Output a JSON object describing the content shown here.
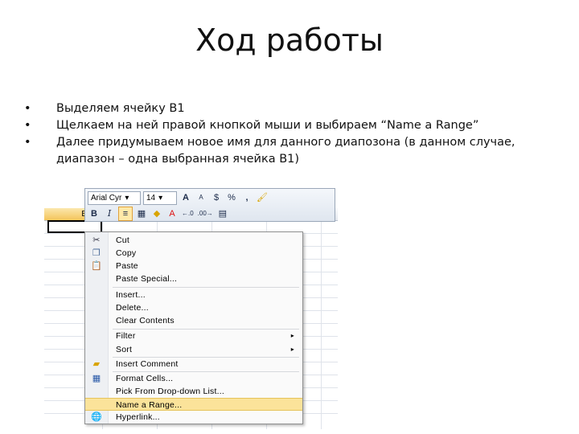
{
  "slide": {
    "title": "Ход работы",
    "bullets": [
      {
        "line1": "Выделяем ячейку B1",
        "line2": ""
      },
      {
        "line1": "Щелкаем на ней правой кнопкой мыши и выбираем “Name a Range”",
        "line2": ""
      },
      {
        "line1": "Далее придумываем новое имя для данного диапозона (в данном случае,",
        "line2": "диапазон – одна выбранная ячейка B1)"
      }
    ],
    "bullet_symbol": "•"
  },
  "screenshot": {
    "column_header": "B",
    "toolbar": {
      "font_name": "Arial Cyr",
      "font_size": "14",
      "dropdown_glyph": "▾",
      "grow_font": "A",
      "shrink_font": "A",
      "currency": "$",
      "percent": "%",
      "comma": ",",
      "format_painter": "🖌",
      "bold": "B",
      "italic": "I",
      "align_center": "≡",
      "borders": "▦",
      "fill_color": "◆",
      "font_color": "A",
      "inc_decimal": "←.0",
      "dec_decimal": ".00→",
      "merge": "▤"
    },
    "menu": {
      "items": [
        {
          "label": "Cut",
          "icon": "scissors-icon",
          "glyph": "✂"
        },
        {
          "label": "Copy",
          "icon": "copy-icon",
          "glyph": "❐"
        },
        {
          "label": "Paste",
          "icon": "paste-icon",
          "glyph": "📋"
        },
        {
          "label": "Paste Special...",
          "icon": "",
          "glyph": ""
        },
        {
          "label": "Insert...",
          "icon": "",
          "glyph": ""
        },
        {
          "label": "Delete...",
          "icon": "",
          "glyph": ""
        },
        {
          "label": "Clear Contents",
          "icon": "",
          "glyph": ""
        },
        {
          "label": "Filter",
          "icon": "",
          "glyph": "",
          "submenu": "▸"
        },
        {
          "label": "Sort",
          "icon": "",
          "glyph": "",
          "submenu": "▸"
        },
        {
          "label": "Insert Comment",
          "icon": "comment-icon",
          "glyph": "▰"
        },
        {
          "label": "Format Cells...",
          "icon": "format-cells-icon",
          "glyph": "▦"
        },
        {
          "label": "Pick From Drop-down List...",
          "icon": "",
          "glyph": ""
        },
        {
          "label": "Name a Range...",
          "icon": "",
          "glyph": ""
        },
        {
          "label": "Hyperlink...",
          "icon": "hyperlink-icon",
          "glyph": "🌐"
        }
      ],
      "highlight_color": "#fbe39a"
    }
  }
}
